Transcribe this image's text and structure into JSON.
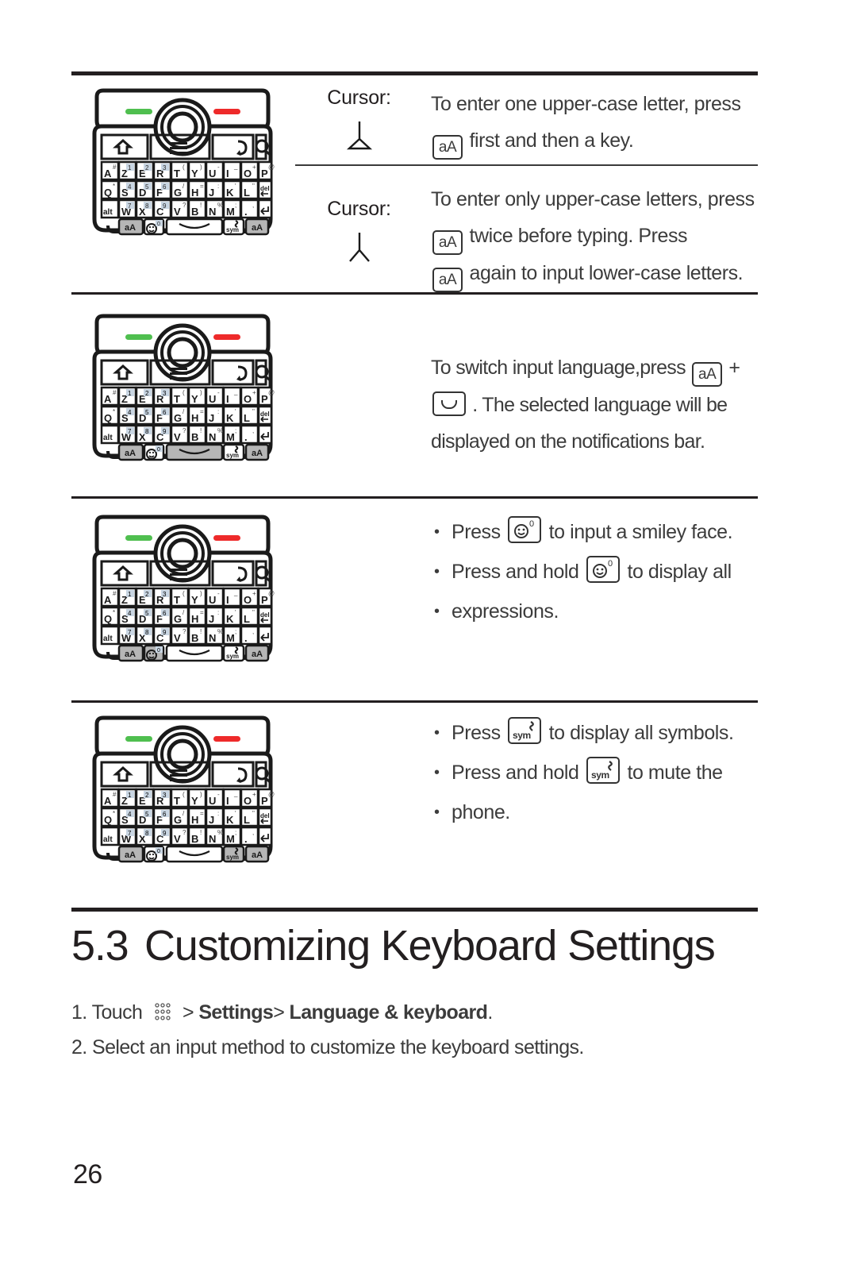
{
  "document": {
    "page_number": "26",
    "section": {
      "number": "5.3",
      "title": "Customizing Keyboard Settings"
    },
    "steps": [
      {
        "index": "1.",
        "prefix": "Touch",
        "icon": "app-grid-icon",
        "sep1": ">",
        "bold1": "Settings",
        "sep2": ">",
        "bold2": "Language & keyboard",
        "suffix": "."
      },
      {
        "index": "2.",
        "text": "Select an input method to customize the keyboard settings."
      }
    ]
  },
  "table": {
    "rows": [
      {
        "id": "shift-single",
        "label": "Cursor:",
        "cursor_glyph": "cursor-arrow-icon",
        "text_parts": [
          "To enter one upper-case letter, press",
          "first and then a key."
        ],
        "key": "aA"
      },
      {
        "id": "shift-lock",
        "label": "Cursor:",
        "cursor_glyph": "cursor-arrow-icon",
        "text_parts": [
          "To enter only upper-case letters, press",
          "twice before typing. Press",
          "again to input lower-case letters."
        ],
        "key": "aA"
      },
      {
        "id": "switch-language",
        "text_parts": [
          "To switch input language,press",
          "+",
          ". The selected language will be",
          "displayed on the notifications bar."
        ],
        "key": "aA",
        "key2": "space-key-icon"
      },
      {
        "id": "smiley",
        "bullets": [
          {
            "before": "Press",
            "key": "smiley-key-icon",
            "after": "to input a smiley face."
          },
          {
            "before": "Press and hold",
            "key": "smiley-key-icon",
            "after": "to display all"
          },
          {
            "continuation": "expressions."
          }
        ]
      },
      {
        "id": "symbols",
        "bullets": [
          {
            "before": "Press",
            "key": "sym-key-icon",
            "after": "to display all symbols."
          },
          {
            "before": "Press and hold",
            "key": "sym-key-icon",
            "after": "to mute the"
          },
          {
            "continuation": "phone."
          }
        ]
      }
    ]
  },
  "keyboard": {
    "leds": {
      "left_color": "#4fbf4f",
      "right_color": "#ee2a2a"
    },
    "nav_keys": [
      "home-icon",
      "menu-icon",
      "trackball",
      "back-icon",
      "search-icon"
    ],
    "rows": [
      {
        "keys": [
          {
            "main": "A",
            "sup": "#"
          },
          {
            "main": "Z",
            "sup": "1",
            "sup_box": true
          },
          {
            "main": "E",
            "sup": "2",
            "sup_box": true
          },
          {
            "main": "R",
            "sup": "3",
            "sup_box": true
          },
          {
            "main": "T",
            "sup": "("
          },
          {
            "main": "Y",
            "sup": ")"
          },
          {
            "main": "U",
            "sup": "-"
          },
          {
            "main": "I",
            "sup": "_"
          },
          {
            "main": "O",
            "sup": "+"
          },
          {
            "main": "P",
            "sup": "@"
          }
        ]
      },
      {
        "keys": [
          {
            "main": "Q",
            "sup": "*"
          },
          {
            "main": "S",
            "sup": "4",
            "sup_box": true
          },
          {
            "main": "D",
            "sup": "5",
            "sup_box": true
          },
          {
            "main": "F",
            "sup": "6",
            "sup_box": true
          },
          {
            "main": "G",
            "sup": "/"
          },
          {
            "main": "H",
            "sup": "="
          },
          {
            "main": "J",
            "sup": ":"
          },
          {
            "main": "K",
            "sup": "'"
          },
          {
            "main": "L",
            "sup": "\""
          },
          {
            "main": "del",
            "small": true
          }
        ]
      },
      {
        "keys": [
          {
            "main": "alt",
            "small": true
          },
          {
            "main": "W",
            "sup": "7",
            "sup_box": true
          },
          {
            "main": "X",
            "sup": "8",
            "sup_box": true
          },
          {
            "main": "C",
            "sup": "9",
            "sup_box": true
          },
          {
            "main": "V",
            "sup": "?"
          },
          {
            "main": "B",
            "sup": "!"
          },
          {
            "main": "N",
            "sup": "%"
          },
          {
            "main": "M",
            "sup": ";"
          },
          {
            "main": ".",
            "sup": ","
          },
          {
            "main": "enter",
            "small": true
          }
        ]
      },
      {
        "bottom": [
          {
            "main": "aA",
            "shaded": true
          },
          {
            "main": "smiley",
            "sup": "0"
          },
          {
            "main": "space"
          },
          {
            "main": "sym"
          },
          {
            "main": "aA",
            "shaded": true
          }
        ]
      }
    ],
    "highlight_by_row": {
      "shift-single": "none",
      "shift-lock": "none",
      "switch-language": "space",
      "smiley": "smiley",
      "symbols": "sym"
    }
  }
}
